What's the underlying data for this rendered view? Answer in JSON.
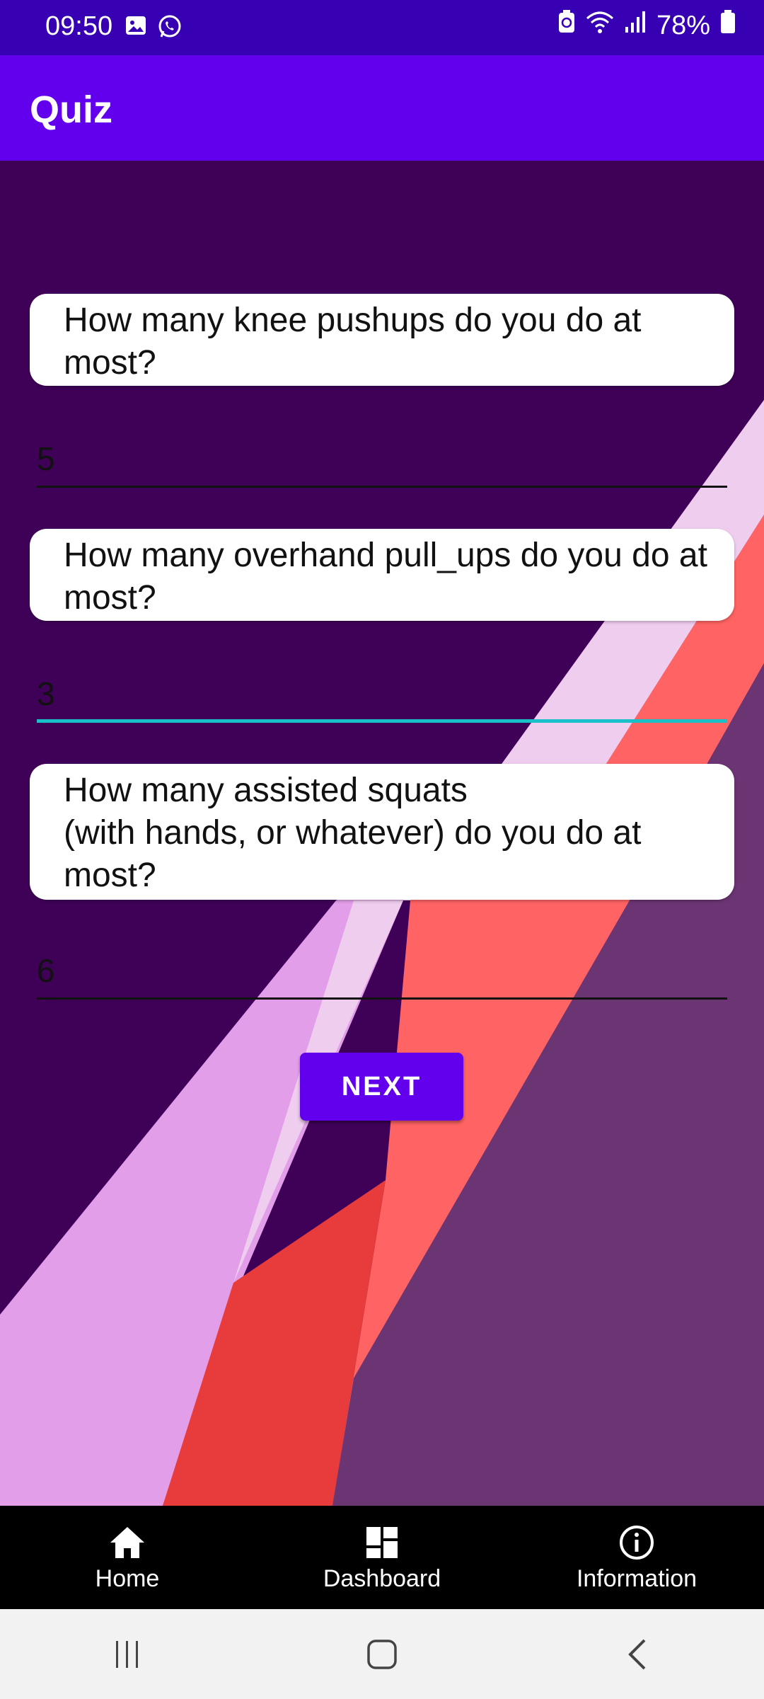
{
  "status_bar": {
    "time": "09:50",
    "battery": "78%",
    "left_icons": [
      "image-icon",
      "whatsapp-icon"
    ],
    "right_icons": [
      "battery-saver-icon",
      "wifi-icon",
      "signal-icon",
      "battery-icon"
    ]
  },
  "app_bar": {
    "title": "Quiz"
  },
  "questions": [
    {
      "question": "How many knee pushups do you do at most?",
      "answer": "5"
    },
    {
      "question": "How many overhand pull_ups do you do at most?",
      "answer": "3"
    },
    {
      "question": "How many assisted squats\n(with hands, or whatever) do you do at most?",
      "answer": "6"
    }
  ],
  "next_button": {
    "label": "NEXT"
  },
  "bottom_nav": {
    "items": [
      {
        "label": "Home",
        "icon": "home-icon"
      },
      {
        "label": "Dashboard",
        "icon": "dashboard-icon"
      },
      {
        "label": "Information",
        "icon": "info-icon"
      }
    ]
  },
  "colors": {
    "status_bar": "#3700b3",
    "app_bar": "#6200ee",
    "background": "#3f0058",
    "focus_accent": "#17c1c7",
    "button": "#6200ee"
  }
}
